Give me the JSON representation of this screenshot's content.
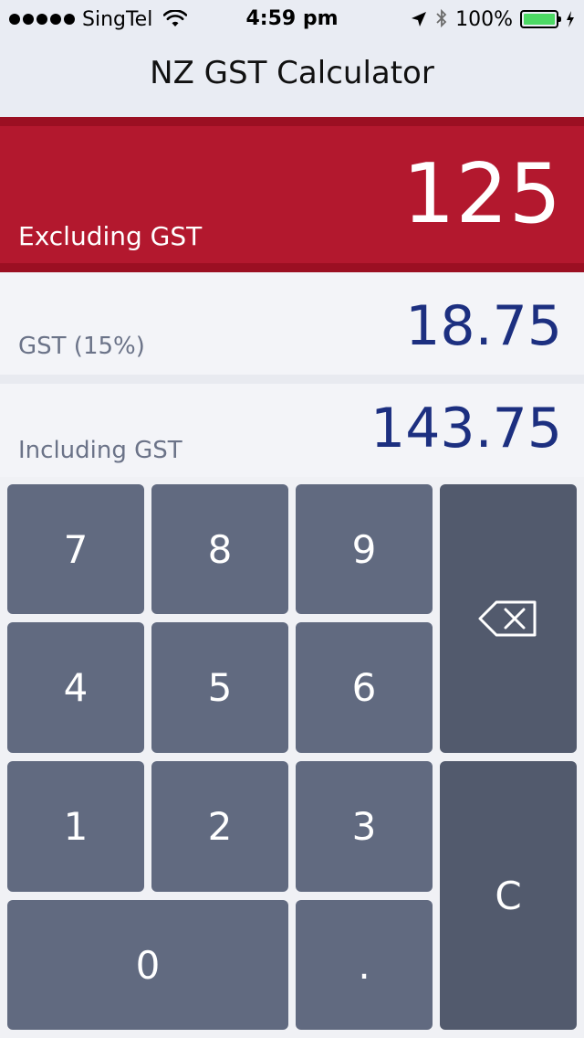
{
  "status_bar": {
    "carrier": "SingTel",
    "time": "4:59 pm",
    "battery_percent": "100%",
    "battery_level": 1.0,
    "icons": [
      "signal-dots-icon",
      "wifi-icon",
      "location-arrow-icon",
      "bluetooth-icon",
      "battery-icon",
      "charging-bolt-icon"
    ]
  },
  "nav": {
    "title": "NZ GST Calculator"
  },
  "excluding": {
    "value": "125",
    "label": "Excluding GST"
  },
  "gst": {
    "value": "18.75",
    "label": "GST (15%)"
  },
  "including": {
    "value": "143.75",
    "label": "Including GST"
  },
  "keypad": {
    "k7": "7",
    "k8": "8",
    "k9": "9",
    "k4": "4",
    "k5": "5",
    "k6": "6",
    "k1": "1",
    "k2": "2",
    "k3": "3",
    "k0": "0",
    "dot": ".",
    "clear": "C",
    "backspace_icon": "backspace-icon"
  },
  "colors": {
    "accent_red": "#b3182e",
    "value_blue": "#1c2f80",
    "key_bg": "#616a80",
    "side_key_bg": "#525a6d"
  }
}
